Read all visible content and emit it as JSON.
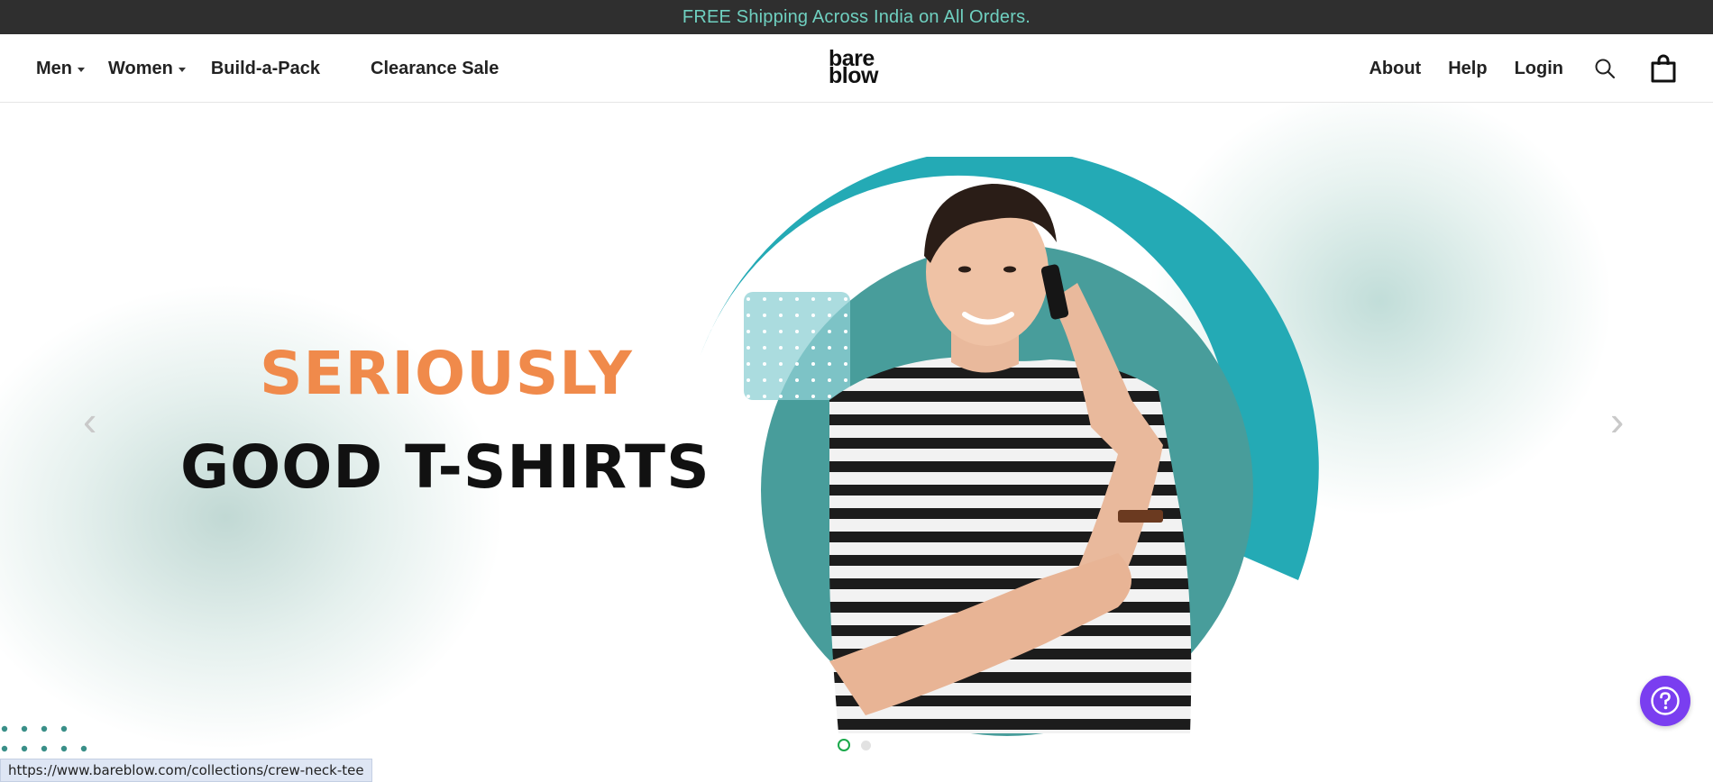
{
  "announcement": "FREE Shipping Across India on All Orders.",
  "nav": {
    "left": [
      {
        "label": "Men",
        "dropdown": true
      },
      {
        "label": "Women",
        "dropdown": true
      },
      {
        "label": "Build-a-Pack",
        "dropdown": false
      },
      {
        "label": "Clearance Sale",
        "dropdown": false
      }
    ],
    "right": [
      {
        "label": "About"
      },
      {
        "label": "Help"
      },
      {
        "label": "Login"
      }
    ],
    "icons": [
      "search-icon",
      "cart-icon"
    ]
  },
  "logo": {
    "line1": "bare",
    "line2": "blow"
  },
  "hero": {
    "headline_top": "SERIOUSLY",
    "headline_bottom": "GOOD T-SHIRTS",
    "slides": 2,
    "active_slide": 1,
    "colors": {
      "accent_orange": "#f08a4b",
      "teal": "#24aab5",
      "teal_dark": "#489d9b"
    }
  },
  "prev_arrow": "‹",
  "next_arrow": "›",
  "status_url": "https://www.bareblow.com/collections/crew-neck-tee",
  "help_fab": {
    "icon": "question-icon",
    "color": "#7a3ef0"
  }
}
